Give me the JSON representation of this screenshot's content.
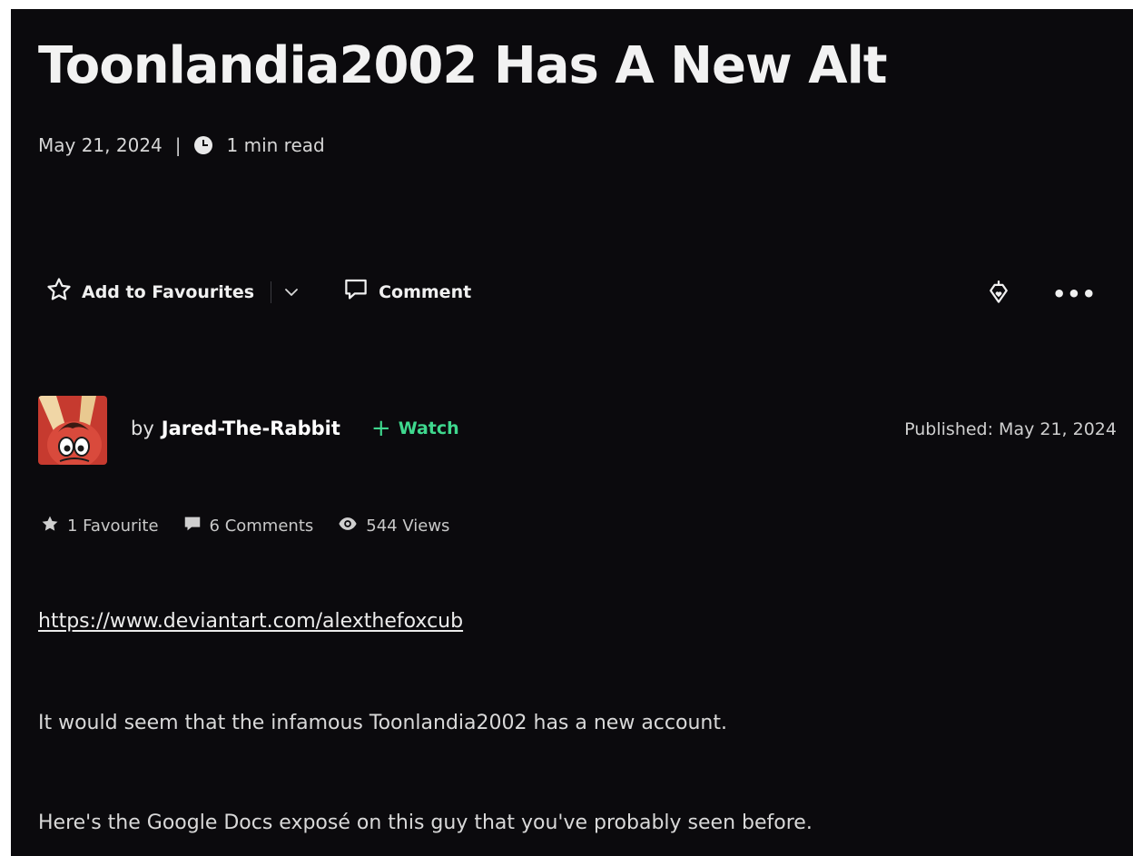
{
  "article": {
    "title": "Toonlandia2002 Has A New Alt",
    "date": "May 21, 2024",
    "separator": "|",
    "read_time": "1 min read"
  },
  "actions": {
    "favourite_label": "Add to Favourites",
    "comment_label": "Comment",
    "more_label": "•••"
  },
  "author": {
    "by_label": "by",
    "name": "Jared-The-Rabbit",
    "watch_plus": "+",
    "watch_label": "Watch",
    "published": "Published: May 21, 2024"
  },
  "stats": {
    "favourites": "1 Favourite",
    "comments": "6 Comments",
    "views": "544 Views"
  },
  "body": {
    "link": "https://www.deviantart.com/alexthefoxcub",
    "paragraphs": [
      "It would seem that the infamous Toonlandia2002 has a new account.",
      "Here's the Google Docs exposé on this guy that you've probably seen before."
    ]
  },
  "colors": {
    "background": "#0b0a0d",
    "text": "#e8e8e8",
    "watch_accent": "#3fd88e"
  },
  "icons": [
    "clock-icon",
    "star-outline-icon",
    "chevron-down-icon",
    "comment-icon",
    "gift-icon",
    "more-icon",
    "star-solid-icon",
    "comment-solid-icon",
    "eye-icon"
  ]
}
